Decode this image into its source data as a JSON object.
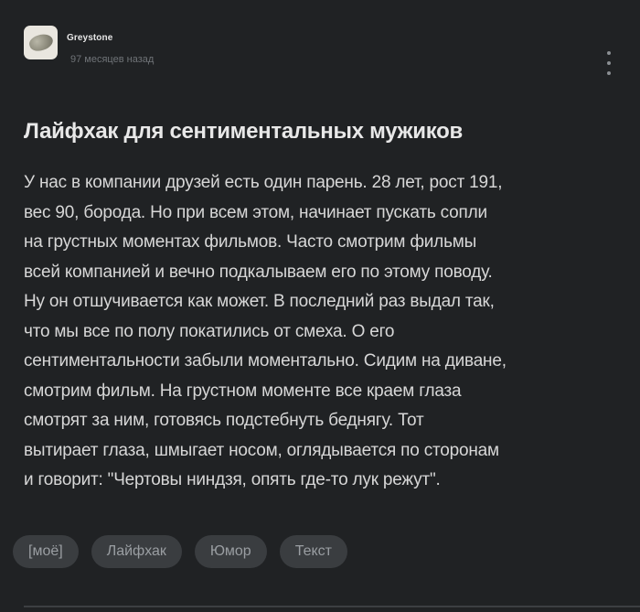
{
  "author": {
    "name": "Greystone",
    "avatar_icon": "stone-avatar-icon"
  },
  "post": {
    "time": "97 месяцев назад",
    "title": "Лайфхак для сентиментальных мужиков",
    "body": "У нас в компании друзей есть один парень. 28 лет, рост 191,\nвес 90, борода. Но при всем этом, начинает пускать сопли\nна грустных моментах фильмов. Часто смотрим фильмы\nвсей компанией и вечно подкалываем его по этому поводу.\nНу он отшучивается как может. В последний раз выдал так,\nчто мы все по полу покатились от смеха. О его\nсентиментальности забыли моментально. Сидим на диване,\nсмотрим фильм. На грустном моменте все краем глаза\nсмотрят за ним, готовясь подстебнуть беднягу. Тот\nвытирает глаза, шмыгает носом, оглядывается по сторонам\nи говорит: \"Чертовы ниндзя, опять где-то лук режут\".",
    "more_icon": "more-vertical-icon"
  },
  "tags": [
    {
      "label": "[моё]"
    },
    {
      "label": "Лайфхак"
    },
    {
      "label": "Юмор"
    },
    {
      "label": "Текст"
    }
  ],
  "colors": {
    "background": "#202224",
    "tag_background": "#3a3d40",
    "muted_text": "#6f7377"
  }
}
